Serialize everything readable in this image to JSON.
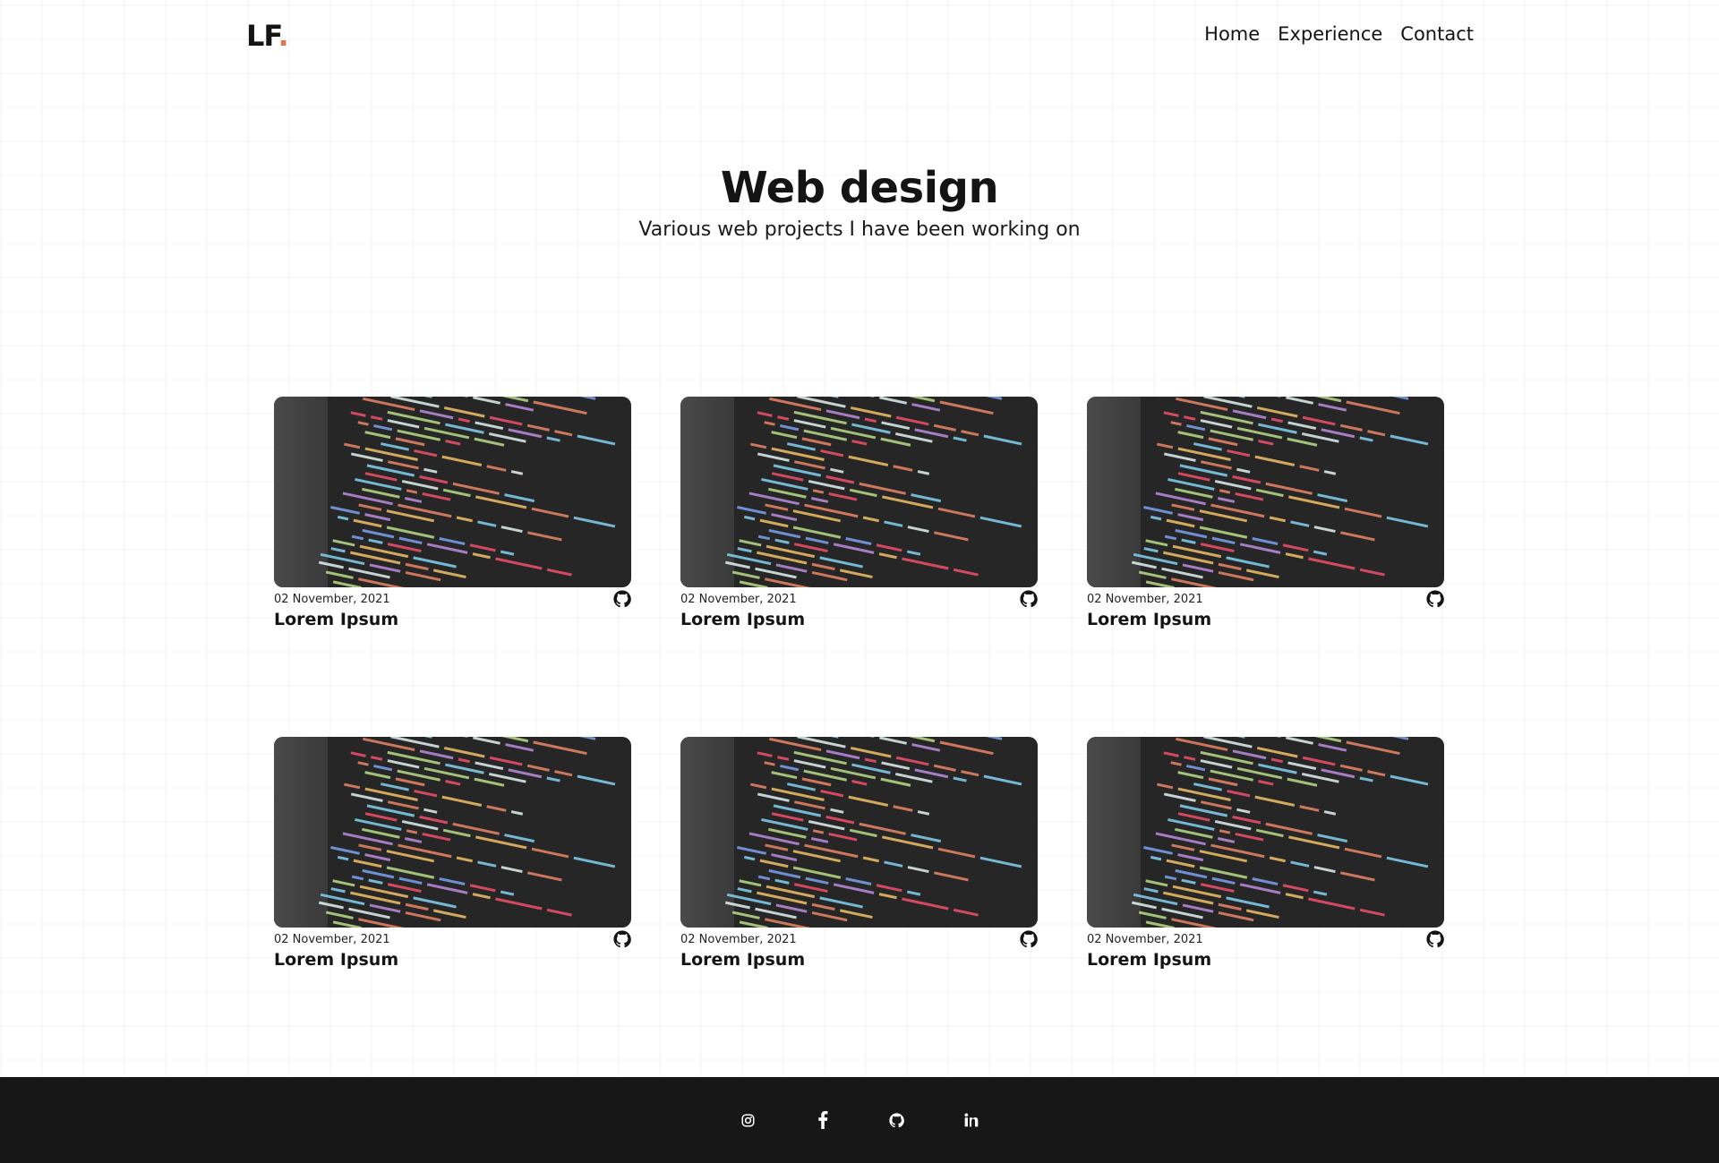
{
  "header": {
    "logo_text": "LF",
    "logo_dot": ".",
    "nav": [
      {
        "label": "Home"
      },
      {
        "label": "Experience"
      },
      {
        "label": "Contact"
      }
    ]
  },
  "hero": {
    "title": "Web design",
    "subtitle": "Various web projects I have been working on"
  },
  "projects": [
    {
      "date": "02 November, 2021",
      "title": "Lorem Ipsum",
      "icon": "github-icon"
    },
    {
      "date": "02 November, 2021",
      "title": "Lorem Ipsum",
      "icon": "github-icon"
    },
    {
      "date": "02 November, 2021",
      "title": "Lorem Ipsum",
      "icon": "github-icon"
    },
    {
      "date": "02 November, 2021",
      "title": "Lorem Ipsum",
      "icon": "github-icon"
    },
    {
      "date": "02 November, 2021",
      "title": "Lorem Ipsum",
      "icon": "github-icon"
    },
    {
      "date": "02 November, 2021",
      "title": "Lorem Ipsum",
      "icon": "github-icon"
    }
  ],
  "footer": {
    "social": [
      "instagram-icon",
      "facebook-icon",
      "github-icon",
      "linkedin-icon"
    ]
  },
  "colors": {
    "accent": "#e8734f",
    "footer_bg": "#171717",
    "thumb_bg": "#262626"
  }
}
